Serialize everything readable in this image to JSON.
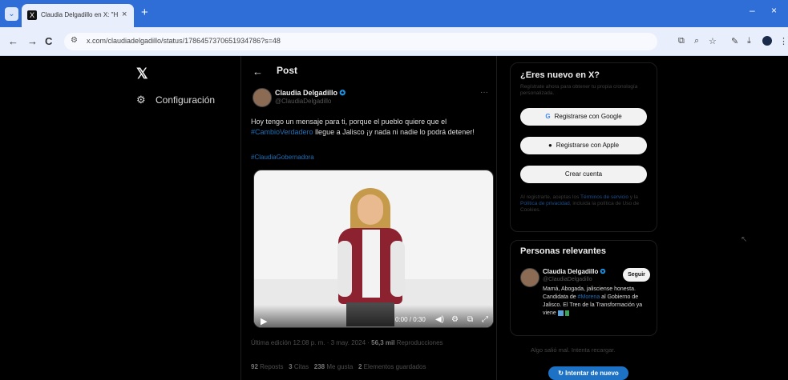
{
  "browser": {
    "tab_title": "Claudia Delgadillo en X: \"Hoy t",
    "tab_close": "×",
    "new_tab": "+",
    "favicon": "X",
    "url": "x.com/claudiadelgadillo/status/1786457370651934786?s=48",
    "back": "←",
    "forward": "→",
    "reload": "C",
    "site_info": "⚙",
    "minimize": "–",
    "close": "×"
  },
  "nav": {
    "logo": "𝕏",
    "config_icon": "⚙",
    "config_label": "Configuración"
  },
  "post": {
    "back_arrow": "←",
    "header_title": "Post",
    "author_name": "Claudia Delgadillo",
    "verified_mark": "✪",
    "author_handle": "@ClaudiaDelgadillo",
    "more": "···",
    "text_before": "Hoy tengo un mensaje para ti, porque el pueblo quiere que el ",
    "text_hashtag": "#CambioVerdadero",
    "text_after": " llegue a Jalisco ¡y nada ni nadie lo podrá detener!",
    "hashtag_line": "#ClaudiaGobernadora",
    "video_time": "0:00 / 0:30",
    "meta": "Última edición 12:08 p. m. · 3 may. 2024 · ",
    "views": "56,3 mil",
    "views_label": " Reproducciones",
    "stats": {
      "reposts_count": "92",
      "reposts_label": "Reposts",
      "quotes_count": "3",
      "quotes_label": "Citas",
      "likes_count": "238",
      "likes_label": "Me gusta",
      "bookmarks_count": "2",
      "bookmarks_label": "Elementos guardados"
    }
  },
  "sidebar": {
    "new_title": "¿Eres nuevo en X?",
    "new_subtitle": "Regístrate ahora para obtener tu propia cronología personalizada.",
    "google_btn": "Registrarse con Google",
    "apple_btn": "Registrarse con Apple",
    "create_btn": "Crear cuenta",
    "legal_before": "Al registrarte, aceptas los ",
    "legal_terms": "Términos de servicio",
    "legal_mid": " y la ",
    "legal_privacy": "Política de privacidad",
    "legal_after": ", incluida la política de Uso de Cookies.",
    "relevant_title": "Personas relevantes",
    "rel_name": "Claudia Delgadillo",
    "rel_handle": "@ClaudiaDelgadillo",
    "follow": "Seguir",
    "bio_before": "Mamá, Abogada, jalisciense honesta. Candidata de ",
    "bio_link": "#Morena",
    "bio_after": " al Gobierno de Jalisco. El Tren de la Transformación ya viene ",
    "error_text": "Algo salió mal. Intenta recargar.",
    "retry_btn": "Intentar de nuevo"
  },
  "colors": {
    "accent": "#1d9bf0",
    "browser_tab_bar": "#2f6ed6",
    "retry_button": "#1d72c6"
  }
}
